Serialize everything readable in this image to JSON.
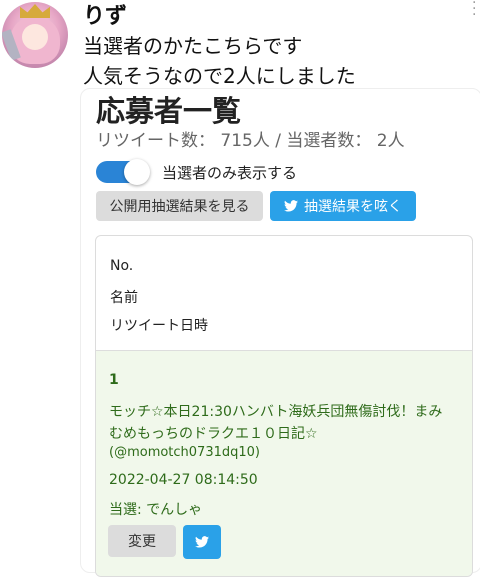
{
  "tweet": {
    "username": "りず",
    "lines": [
      "当選者のかたこちらです",
      "人気そうなので2人にしました"
    ]
  },
  "page": {
    "title": "応募者一覧",
    "stats": "リツイート数： 715人 / 当選者数： 2人",
    "toggle_label": "当選者のみ表示する",
    "toggle_on": true,
    "public_button": "公開用抽選結果を見る",
    "tweet_button": "抽選結果を呟く"
  },
  "table": {
    "headers": [
      "No.",
      "名前",
      "リツイート日時"
    ],
    "rows": [
      {
        "no": "1",
        "name_line1": "モッチ☆本日21:30ハンバト海妖兵団無傷討伐！まみ",
        "name_line2": "むめもっちのドラクエ１０日記☆",
        "handle": "(@momotch0731dq10)",
        "datetime": "2022-04-27 08:14:50",
        "winner": "当選: でんしゃ",
        "change_button": "変更"
      }
    ]
  },
  "colors": {
    "accent": "#2aa1e8",
    "toggle": "#2a84d6",
    "row_bg": "#f1f8eb",
    "row_text": "#2e6b1a"
  },
  "icons": [
    "avatar",
    "more-dots-icon",
    "twitter-bird-icon"
  ]
}
